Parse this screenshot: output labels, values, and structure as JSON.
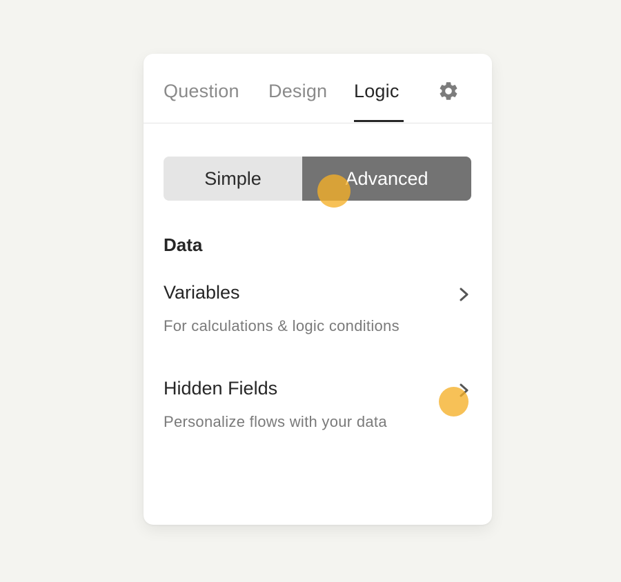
{
  "tabs": {
    "question": "Question",
    "design": "Design",
    "logic": "Logic",
    "active": "Logic"
  },
  "settings_icon": "gear-icon",
  "mode_toggle": {
    "simple": "Simple",
    "advanced": "Advanced",
    "selected": "Advanced"
  },
  "data_section": {
    "title": "Data",
    "items": [
      {
        "title": "Variables",
        "description": "For calculations & logic conditions",
        "icon": "chevron-right-icon"
      },
      {
        "title": "Hidden Fields",
        "description": "Personalize flows with your data",
        "icon": "chevron-right-icon"
      }
    ]
  },
  "colors": {
    "background": "#f4f4f0",
    "panel": "#ffffff",
    "active_text": "#262626",
    "inactive_text": "#8a8a8a",
    "segment_inactive": "#e5e5e5",
    "segment_active": "#737373",
    "touch_indicator": "#f5b028"
  }
}
